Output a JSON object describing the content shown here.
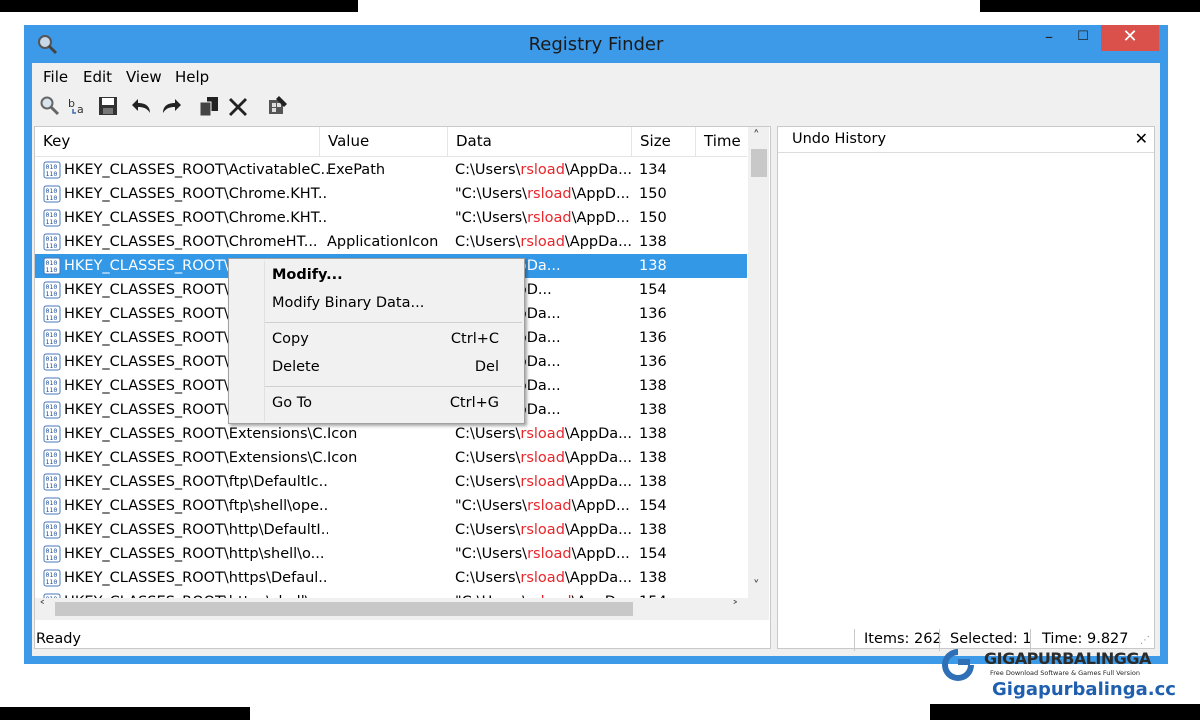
{
  "window": {
    "title": "Registry Finder",
    "minimize": "–",
    "maximize": "☐",
    "close": "✕"
  },
  "menu": [
    "File",
    "Edit",
    "View",
    "Help"
  ],
  "toolbar": [
    "find-icon",
    "replace-icon",
    "save-icon",
    "undo-icon",
    "redo-icon",
    "copy-icon",
    "delete-icon",
    "regedit-icon"
  ],
  "columns": [
    "Key",
    "Value",
    "Data",
    "Size",
    "Time"
  ],
  "rows": [
    {
      "key": "HKEY_CLASSES_ROOT\\ActivatableC...",
      "value": "ExePath",
      "data_pre": "C:\\Users\\",
      "data_hl": "rsload",
      "data_post": "\\AppDa...",
      "size": "134"
    },
    {
      "key": "HKEY_CLASSES_ROOT\\Chrome.KHT...",
      "value": "",
      "data_pre": "\"C:\\Users\\",
      "data_hl": "rsload",
      "data_post": "\\AppD...",
      "size": "150"
    },
    {
      "key": "HKEY_CLASSES_ROOT\\Chrome.KHT...",
      "value": "",
      "data_pre": "\"C:\\Users\\",
      "data_hl": "rsload",
      "data_post": "\\AppD...",
      "size": "150"
    },
    {
      "key": "HKEY_CLASSES_ROOT\\ChromeHT...",
      "value": "ApplicationIcon",
      "data_pre": "C:\\Users\\",
      "data_hl": "rsload",
      "data_post": "\\AppDa...",
      "size": "138"
    },
    {
      "key": "HKEY_CLASSES_ROOT\\C",
      "value": "",
      "data_pre": "",
      "data_hl": "sload",
      "data_post": "\\AppDa...",
      "size": "138"
    },
    {
      "key": "HKEY_CLASSES_ROOT\\C",
      "value": "",
      "data_pre": "",
      "data_hl": "sload",
      "data_post": "\\AppD...",
      "size": "154"
    },
    {
      "key": "HKEY_CLASSES_ROOT\\C",
      "value": "",
      "data_pre": "",
      "data_hl": "sload",
      "data_post": "\\AppDa...",
      "size": "136"
    },
    {
      "key": "HKEY_CLASSES_ROOT\\C",
      "value": "",
      "data_pre": "",
      "data_hl": "sload",
      "data_post": "\\AppDa...",
      "size": "136"
    },
    {
      "key": "HKEY_CLASSES_ROOT\\C",
      "value": "",
      "data_pre": "",
      "data_hl": "sload",
      "data_post": "\\AppDa...",
      "size": "136"
    },
    {
      "key": "HKEY_CLASSES_ROOT\\E",
      "value": "",
      "data_pre": "",
      "data_hl": "sload",
      "data_post": "\\AppDa...",
      "size": "138"
    },
    {
      "key": "HKEY_CLASSES_ROOT\\E",
      "value": "",
      "data_pre": "",
      "data_hl": "sload",
      "data_post": "\\AppDa...",
      "size": "138"
    },
    {
      "key": "HKEY_CLASSES_ROOT\\Extensions\\C...",
      "value": "Icon",
      "data_pre": "C:\\Users\\",
      "data_hl": "rsload",
      "data_post": "\\AppDa...",
      "size": "138"
    },
    {
      "key": "HKEY_CLASSES_ROOT\\Extensions\\C...",
      "value": "Icon",
      "data_pre": "C:\\Users\\",
      "data_hl": "rsload",
      "data_post": "\\AppDa...",
      "size": "138"
    },
    {
      "key": "HKEY_CLASSES_ROOT\\ftp\\DefaultIc...",
      "value": "",
      "data_pre": "C:\\Users\\",
      "data_hl": "rsload",
      "data_post": "\\AppDa...",
      "size": "138"
    },
    {
      "key": "HKEY_CLASSES_ROOT\\ftp\\shell\\ope...",
      "value": "",
      "data_pre": "\"C:\\Users\\",
      "data_hl": "rsload",
      "data_post": "\\AppD...",
      "size": "154"
    },
    {
      "key": "HKEY_CLASSES_ROOT\\http\\DefaultI...",
      "value": "",
      "data_pre": "C:\\Users\\",
      "data_hl": "rsload",
      "data_post": "\\AppDa...",
      "size": "138"
    },
    {
      "key": "HKEY_CLASSES_ROOT\\http\\shell\\o...",
      "value": "",
      "data_pre": "\"C:\\Users\\",
      "data_hl": "rsload",
      "data_post": "\\AppD...",
      "size": "154"
    },
    {
      "key": "HKEY_CLASSES_ROOT\\https\\Defaul...",
      "value": "",
      "data_pre": "C:\\Users\\",
      "data_hl": "rsload",
      "data_post": "\\AppDa...",
      "size": "138"
    },
    {
      "key": "HKEY_CLASSES_ROOT\\https\\shell\\o...",
      "value": "",
      "data_pre": "\"C:\\Users\\",
      "data_hl": "rsload",
      "data_post": "\\AppD...",
      "size": "154"
    }
  ],
  "selected_row": 4,
  "undo": {
    "title": "Undo History",
    "close": "✕"
  },
  "context_menu": {
    "modify": "Modify...",
    "modify_binary": "Modify Binary Data...",
    "copy": "Copy",
    "copy_shortcut": "Ctrl+C",
    "delete": "Delete",
    "delete_shortcut": "Del",
    "goto": "Go To",
    "goto_shortcut": "Ctrl+G"
  },
  "status": {
    "ready": "Ready",
    "items": "Items: 262",
    "selected": "Selected: 1",
    "time": "Time: 9.827"
  },
  "watermark": {
    "brand": "GIGAPURBALINGGA",
    "tagline": "Free Download Software & Games Full Version",
    "site": "Gigapurbalinga.cc"
  },
  "colors": {
    "window_frame": "#3d9ae8",
    "selection": "#3398e6",
    "highlight_text": "#e8262c",
    "close_button": "#d9514a"
  }
}
